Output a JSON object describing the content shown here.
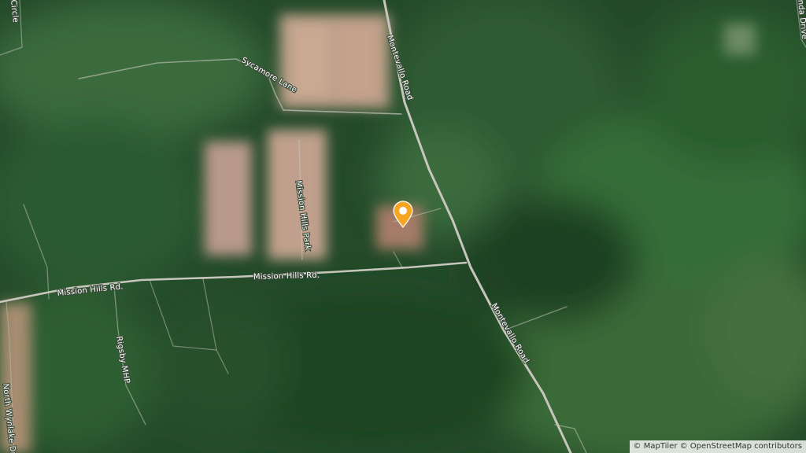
{
  "map": {
    "roads": {
      "montevallo_road_north": "Montevallo Road",
      "montevallo_road_south": "Montevallo Road",
      "mission_hills_rd_west": "Mission Hills Rd.",
      "mission_hills_rd_east": "Mission Hills Rd.",
      "mission_hills_park": "Mission Hills Park",
      "sycamore_lane": "Sycamore Lane",
      "rigsby_mhp": "Rigsby MHP",
      "north_wynlake_dr": "North Wynlake Dr",
      "circle_partial": "Circle",
      "anda_drive_partial": "nda Drive"
    },
    "marker": {
      "icon": "location-pin-icon",
      "color": "#f5a623"
    },
    "attribution": {
      "maptiler": "© MapTiler",
      "osm": "© OpenStreetMap contributors"
    }
  }
}
